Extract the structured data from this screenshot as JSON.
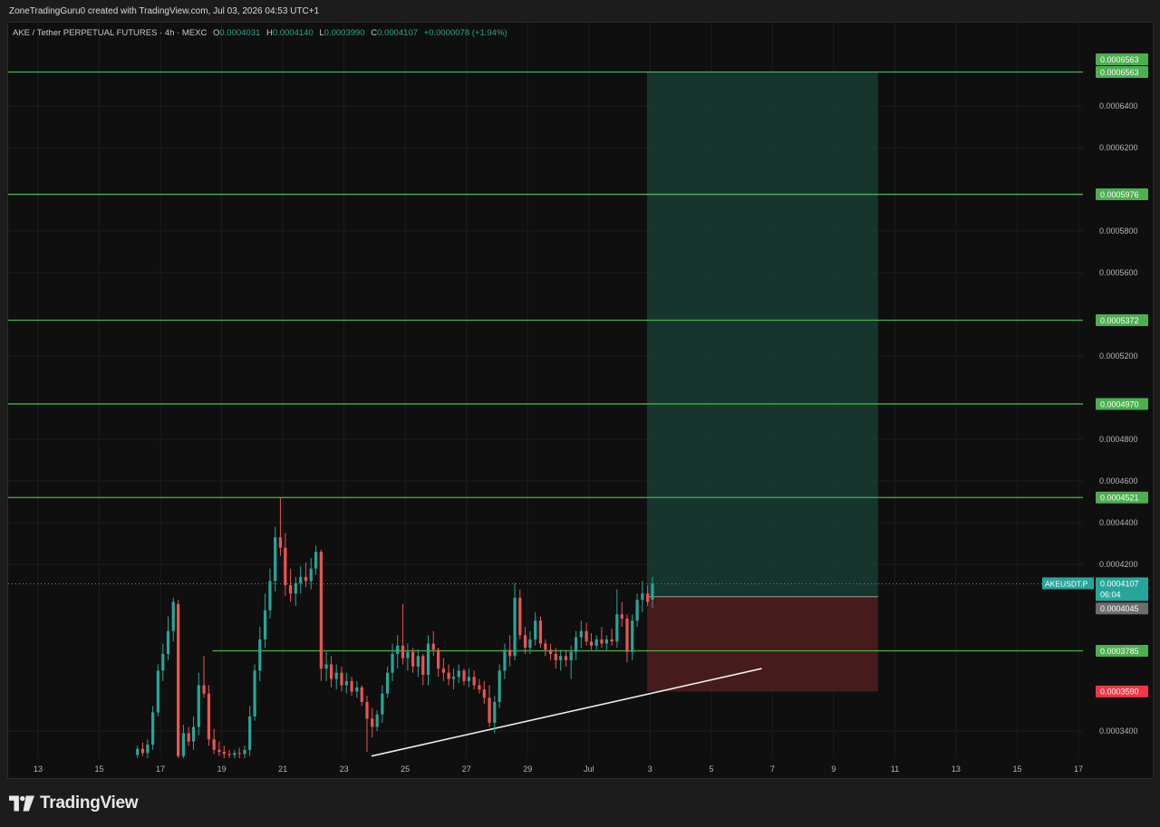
{
  "header": {
    "credit": "ZoneTradingGuru0 created with TradingView.com, Jul 03, 2026 04:53 UTC+1"
  },
  "legend": {
    "symbol": "AKE / Tether PERPETUAL FUTURES · 4h · MEXC",
    "o_label": "O",
    "o": "0.0004031",
    "h_label": "H",
    "h": "0.0004140",
    "l_label": "L",
    "l": "0.0003990",
    "c_label": "C",
    "c": "0.0004107",
    "change": "+0.0000078 (+1.94%)"
  },
  "footer": {
    "brand": "TradingView"
  },
  "colors": {
    "up": "#26a69a",
    "down": "#ef5350",
    "level_line": "#4caf50",
    "target_zone": "#17382f",
    "stop_zone": "#4a1c1e",
    "price_tag": "#26a69a",
    "level_tag": "#4caf50",
    "entry_tag": "#6e6e6e",
    "stop_tag": "#f23645"
  },
  "chart_data": {
    "type": "candlestick",
    "timeframe": "4h",
    "exchange": "MEXC",
    "ylim": [
      0.000327,
      0.00068
    ],
    "y_ticks": [
      "0.0003400",
      "0.0004200",
      "0.0004400",
      "0.0004600",
      "0.0004800",
      "0.0005200",
      "0.0005600",
      "0.0005800",
      "0.0006200",
      "0.0006400"
    ],
    "x_ticks": [
      {
        "label": "13",
        "t": 13
      },
      {
        "label": "15",
        "t": 15
      },
      {
        "label": "17",
        "t": 17
      },
      {
        "label": "19",
        "t": 19
      },
      {
        "label": "21",
        "t": 21
      },
      {
        "label": "23",
        "t": 23
      },
      {
        "label": "25",
        "t": 25
      },
      {
        "label": "27",
        "t": 27
      },
      {
        "label": "29",
        "t": 29
      },
      {
        "label": "Jul",
        "t": 31
      },
      {
        "label": "3",
        "t": 33
      },
      {
        "label": "5",
        "t": 35
      },
      {
        "label": "7",
        "t": 37
      },
      {
        "label": "9",
        "t": 39
      },
      {
        "label": "11",
        "t": 41
      },
      {
        "label": "13",
        "t": 43
      },
      {
        "label": "15",
        "t": 45
      },
      {
        "label": "17",
        "t": 47
      }
    ],
    "levels": [
      {
        "price": 0.0006563,
        "label": "0.0006563"
      },
      {
        "price": 0.0005976,
        "label": "0.0005976"
      },
      {
        "price": 0.0005372,
        "label": "0.0005372"
      },
      {
        "price": 0.000497,
        "label": "0.0004970"
      },
      {
        "price": 0.0004521,
        "label": "0.0004521"
      },
      {
        "price": 0.0003785,
        "label": "0.0003785"
      }
    ],
    "current_price": {
      "price": 0.0004107,
      "label": "0.0004107",
      "symbol": "AKEUSDT.P",
      "countdown": "06:04"
    },
    "position": {
      "entry": 0.0004045,
      "entry_label": "0.0004045",
      "target": 0.0006563,
      "target_label": "0.0006563",
      "stop": 0.000359,
      "stop_label": "0.0003590",
      "t_start": 32.9,
      "t_end": 40.45
    },
    "trendline": {
      "t1": 23.9,
      "p1": 0.000328,
      "t2": 36.65,
      "p2": 0.00037
    },
    "candles": [
      {
        "t": 16.25,
        "o": 0.0003285,
        "h": 0.000333,
        "l": 0.000327,
        "c": 0.0003315
      },
      {
        "t": 16.42,
        "o": 0.0003315,
        "h": 0.0003345,
        "l": 0.000328,
        "c": 0.0003295
      },
      {
        "t": 16.58,
        "o": 0.0003295,
        "h": 0.000336,
        "l": 0.000327,
        "c": 0.0003335
      },
      {
        "t": 16.75,
        "o": 0.0003335,
        "h": 0.000352,
        "l": 0.000331,
        "c": 0.000349
      },
      {
        "t": 16.92,
        "o": 0.000349,
        "h": 0.000372,
        "l": 0.000347,
        "c": 0.000369
      },
      {
        "t": 17.08,
        "o": 0.000369,
        "h": 0.000382,
        "l": 0.000364,
        "c": 0.000377
      },
      {
        "t": 17.25,
        "o": 0.000377,
        "h": 0.000395,
        "l": 0.000374,
        "c": 0.000388
      },
      {
        "t": 17.42,
        "o": 0.000388,
        "h": 0.000404,
        "l": 0.000383,
        "c": 0.000402
      },
      {
        "t": 17.58,
        "o": 0.000401,
        "h": 0.000403,
        "l": 0.000327,
        "c": 0.000328
      },
      {
        "t": 17.75,
        "o": 0.000328,
        "h": 0.000343,
        "l": 0.000327,
        "c": 0.000339
      },
      {
        "t": 17.92,
        "o": 0.000339,
        "h": 0.000342,
        "l": 0.000333,
        "c": 0.000335
      },
      {
        "t": 18.08,
        "o": 0.000335,
        "h": 0.000347,
        "l": 0.000331,
        "c": 0.000342
      },
      {
        "t": 18.25,
        "o": 0.000342,
        "h": 0.000368,
        "l": 0.000338,
        "c": 0.000362
      },
      {
        "t": 18.42,
        "o": 0.000362,
        "h": 0.000376,
        "l": 0.000356,
        "c": 0.000358
      },
      {
        "t": 18.58,
        "o": 0.000358,
        "h": 0.000362,
        "l": 0.000333,
        "c": 0.000336
      },
      {
        "t": 18.75,
        "o": 0.000336,
        "h": 0.000341,
        "l": 0.000329,
        "c": 0.000331
      },
      {
        "t": 18.92,
        "o": 0.000331,
        "h": 0.000335,
        "l": 0.000328,
        "c": 0.00033
      },
      {
        "t": 19.08,
        "o": 0.00033,
        "h": 0.000333,
        "l": 0.000327,
        "c": 0.000329
      },
      {
        "t": 19.25,
        "o": 0.000329,
        "h": 0.000331,
        "l": 0.000327,
        "c": 0.0003285
      },
      {
        "t": 19.42,
        "o": 0.0003285,
        "h": 0.000331,
        "l": 0.000327,
        "c": 0.0003295
      },
      {
        "t": 19.58,
        "o": 0.0003295,
        "h": 0.000332,
        "l": 0.000327,
        "c": 0.000329
      },
      {
        "t": 19.75,
        "o": 0.000329,
        "h": 0.000333,
        "l": 0.000327,
        "c": 0.000331
      },
      {
        "t": 19.92,
        "o": 0.000331,
        "h": 0.000352,
        "l": 0.000328,
        "c": 0.000347
      },
      {
        "t": 20.08,
        "o": 0.000347,
        "h": 0.000372,
        "l": 0.000345,
        "c": 0.000369
      },
      {
        "t": 20.25,
        "o": 0.000369,
        "h": 0.00039,
        "l": 0.000364,
        "c": 0.000384
      },
      {
        "t": 20.42,
        "o": 0.000384,
        "h": 0.000406,
        "l": 0.00038,
        "c": 0.000398
      },
      {
        "t": 20.58,
        "o": 0.000398,
        "h": 0.000418,
        "l": 0.000394,
        "c": 0.000412
      },
      {
        "t": 20.75,
        "o": 0.000412,
        "h": 0.000438,
        "l": 0.000407,
        "c": 0.000433
      },
      {
        "t": 20.92,
        "o": 0.000433,
        "h": 0.000452,
        "l": 0.000424,
        "c": 0.000428
      },
      {
        "t": 21.08,
        "o": 0.000428,
        "h": 0.000435,
        "l": 0.000405,
        "c": 0.00041
      },
      {
        "t": 21.25,
        "o": 0.00041,
        "h": 0.000418,
        "l": 0.000402,
        "c": 0.000406
      },
      {
        "t": 21.42,
        "o": 0.000406,
        "h": 0.000414,
        "l": 0.0004,
        "c": 0.000411
      },
      {
        "t": 21.58,
        "o": 0.000411,
        "h": 0.000419,
        "l": 0.000406,
        "c": 0.000414
      },
      {
        "t": 21.75,
        "o": 0.000414,
        "h": 0.000421,
        "l": 0.000409,
        "c": 0.000412
      },
      {
        "t": 21.92,
        "o": 0.000412,
        "h": 0.000423,
        "l": 0.000408,
        "c": 0.000418
      },
      {
        "t": 22.08,
        "o": 0.000418,
        "h": 0.000429,
        "l": 0.000415,
        "c": 0.000426
      },
      {
        "t": 22.25,
        "o": 0.000426,
        "h": 0.000427,
        "l": 0.000364,
        "c": 0.00037
      },
      {
        "t": 22.42,
        "o": 0.00037,
        "h": 0.000378,
        "l": 0.000364,
        "c": 0.000372
      },
      {
        "t": 22.58,
        "o": 0.000372,
        "h": 0.000376,
        "l": 0.000361,
        "c": 0.000365
      },
      {
        "t": 22.75,
        "o": 0.000365,
        "h": 0.000372,
        "l": 0.00036,
        "c": 0.000368
      },
      {
        "t": 22.92,
        "o": 0.000368,
        "h": 0.000371,
        "l": 0.000359,
        "c": 0.000362
      },
      {
        "t": 23.08,
        "o": 0.000362,
        "h": 0.000368,
        "l": 0.000358,
        "c": 0.000364
      },
      {
        "t": 23.25,
        "o": 0.000364,
        "h": 0.000366,
        "l": 0.000357,
        "c": 0.000359
      },
      {
        "t": 23.42,
        "o": 0.000359,
        "h": 0.000364,
        "l": 0.000356,
        "c": 0.000361
      },
      {
        "t": 23.58,
        "o": 0.000361,
        "h": 0.000362,
        "l": 0.000352,
        "c": 0.000354
      },
      {
        "t": 23.75,
        "o": 0.000354,
        "h": 0.000357,
        "l": 0.00033,
        "c": 0.000346
      },
      {
        "t": 23.92,
        "o": 0.000346,
        "h": 0.000351,
        "l": 0.000337,
        "c": 0.000342
      },
      {
        "t": 24.08,
        "o": 0.000342,
        "h": 0.00035,
        "l": 0.00034,
        "c": 0.000348
      },
      {
        "t": 24.25,
        "o": 0.000348,
        "h": 0.000362,
        "l": 0.000344,
        "c": 0.000358
      },
      {
        "t": 24.42,
        "o": 0.000358,
        "h": 0.000371,
        "l": 0.000356,
        "c": 0.000368
      },
      {
        "t": 24.58,
        "o": 0.000368,
        "h": 0.000382,
        "l": 0.000364,
        "c": 0.000377
      },
      {
        "t": 24.75,
        "o": 0.000377,
        "h": 0.000386,
        "l": 0.00037,
        "c": 0.000381
      },
      {
        "t": 24.92,
        "o": 0.000381,
        "h": 0.000401,
        "l": 0.000372,
        "c": 0.000375
      },
      {
        "t": 25.08,
        "o": 0.000375,
        "h": 0.000382,
        "l": 0.000369,
        "c": 0.000378
      },
      {
        "t": 25.25,
        "o": 0.000378,
        "h": 0.00038,
        "l": 0.000368,
        "c": 0.000371
      },
      {
        "t": 25.42,
        "o": 0.000371,
        "h": 0.000379,
        "l": 0.000366,
        "c": 0.000376
      },
      {
        "t": 25.58,
        "o": 0.000376,
        "h": 0.000377,
        "l": 0.000362,
        "c": 0.000367
      },
      {
        "t": 25.75,
        "o": 0.000367,
        "h": 0.000386,
        "l": 0.000362,
        "c": 0.000382
      },
      {
        "t": 25.92,
        "o": 0.000382,
        "h": 0.000388,
        "l": 0.000376,
        "c": 0.000379
      },
      {
        "t": 26.08,
        "o": 0.000379,
        "h": 0.00038,
        "l": 0.000366,
        "c": 0.00037
      },
      {
        "t": 26.25,
        "o": 0.00037,
        "h": 0.000375,
        "l": 0.000364,
        "c": 0.000368
      },
      {
        "t": 26.42,
        "o": 0.000368,
        "h": 0.000372,
        "l": 0.000362,
        "c": 0.000365
      },
      {
        "t": 26.58,
        "o": 0.000365,
        "h": 0.00037,
        "l": 0.00036,
        "c": 0.000366
      },
      {
        "t": 26.75,
        "o": 0.000366,
        "h": 0.000372,
        "l": 0.000363,
        "c": 0.000369
      },
      {
        "t": 26.92,
        "o": 0.000369,
        "h": 0.00037,
        "l": 0.000362,
        "c": 0.000364
      },
      {
        "t": 27.08,
        "o": 0.000364,
        "h": 0.00037,
        "l": 0.000361,
        "c": 0.000366
      },
      {
        "t": 27.25,
        "o": 0.000366,
        "h": 0.000369,
        "l": 0.00036,
        "c": 0.000362
      },
      {
        "t": 27.42,
        "o": 0.000362,
        "h": 0.000365,
        "l": 0.000358,
        "c": 0.00036
      },
      {
        "t": 27.58,
        "o": 0.00036,
        "h": 0.000364,
        "l": 0.000353,
        "c": 0.000356
      },
      {
        "t": 27.75,
        "o": 0.000356,
        "h": 0.000362,
        "l": 0.000342,
        "c": 0.000344
      },
      {
        "t": 27.92,
        "o": 0.000344,
        "h": 0.000357,
        "l": 0.000339,
        "c": 0.000354
      },
      {
        "t": 28.08,
        "o": 0.000354,
        "h": 0.000372,
        "l": 0.000351,
        "c": 0.000369
      },
      {
        "t": 28.25,
        "o": 0.000369,
        "h": 0.000382,
        "l": 0.000365,
        "c": 0.000379
      },
      {
        "t": 28.42,
        "o": 0.000379,
        "h": 0.000386,
        "l": 0.000371,
        "c": 0.000376
      },
      {
        "t": 28.58,
        "o": 0.000376,
        "h": 0.000411,
        "l": 0.000374,
        "c": 0.000404
      },
      {
        "t": 28.75,
        "o": 0.000404,
        "h": 0.000408,
        "l": 0.000384,
        "c": 0.000386
      },
      {
        "t": 28.92,
        "o": 0.000386,
        "h": 0.00039,
        "l": 0.000377,
        "c": 0.00038
      },
      {
        "t": 29.08,
        "o": 0.00038,
        "h": 0.000388,
        "l": 0.000377,
        "c": 0.000384
      },
      {
        "t": 29.25,
        "o": 0.000384,
        "h": 0.000397,
        "l": 0.000381,
        "c": 0.000393
      },
      {
        "t": 29.42,
        "o": 0.000393,
        "h": 0.000395,
        "l": 0.00038,
        "c": 0.000382
      },
      {
        "t": 29.58,
        "o": 0.000382,
        "h": 0.000384,
        "l": 0.000376,
        "c": 0.000379
      },
      {
        "t": 29.75,
        "o": 0.000379,
        "h": 0.000382,
        "l": 0.000374,
        "c": 0.000377
      },
      {
        "t": 29.92,
        "o": 0.000377,
        "h": 0.00038,
        "l": 0.00037,
        "c": 0.000374
      },
      {
        "t": 30.08,
        "o": 0.000374,
        "h": 0.000379,
        "l": 0.000369,
        "c": 0.000376
      },
      {
        "t": 30.25,
        "o": 0.000376,
        "h": 0.000379,
        "l": 0.000371,
        "c": 0.000374
      },
      {
        "t": 30.42,
        "o": 0.000374,
        "h": 0.000381,
        "l": 0.000365,
        "c": 0.000378
      },
      {
        "t": 30.58,
        "o": 0.000378,
        "h": 0.000388,
        "l": 0.000374,
        "c": 0.000385
      },
      {
        "t": 30.75,
        "o": 0.000385,
        "h": 0.000393,
        "l": 0.00038,
        "c": 0.000388
      },
      {
        "t": 30.92,
        "o": 0.000388,
        "h": 0.000392,
        "l": 0.000381,
        "c": 0.000383
      },
      {
        "t": 31.08,
        "o": 0.000383,
        "h": 0.000387,
        "l": 0.000379,
        "c": 0.000381
      },
      {
        "t": 31.25,
        "o": 0.000381,
        "h": 0.000386,
        "l": 0.000379,
        "c": 0.000384
      },
      {
        "t": 31.42,
        "o": 0.000384,
        "h": 0.00039,
        "l": 0.00038,
        "c": 0.000382
      },
      {
        "t": 31.58,
        "o": 0.000382,
        "h": 0.000386,
        "l": 0.000379,
        "c": 0.000384
      },
      {
        "t": 31.75,
        "o": 0.000384,
        "h": 0.000389,
        "l": 0.000381,
        "c": 0.000383
      },
      {
        "t": 31.92,
        "o": 0.000383,
        "h": 0.000408,
        "l": 0.00038,
        "c": 0.000396
      },
      {
        "t": 32.08,
        "o": 0.000396,
        "h": 0.000402,
        "l": 0.00039,
        "c": 0.000394
      },
      {
        "t": 32.25,
        "o": 0.000394,
        "h": 0.000396,
        "l": 0.000373,
        "c": 0.000378
      },
      {
        "t": 32.42,
        "o": 0.000378,
        "h": 0.000396,
        "l": 0.000374,
        "c": 0.000393
      },
      {
        "t": 32.58,
        "o": 0.000393,
        "h": 0.000406,
        "l": 0.00039,
        "c": 0.000403
      },
      {
        "t": 32.75,
        "o": 0.000403,
        "h": 0.000412,
        "l": 0.000397,
        "c": 0.000406
      },
      {
        "t": 32.92,
        "o": 0.000406,
        "h": 0.00041,
        "l": 0.0004,
        "c": 0.000402
      },
      {
        "t": 33.08,
        "o": 0.0004031,
        "h": 0.000414,
        "l": 0.000399,
        "c": 0.0004107
      }
    ]
  }
}
